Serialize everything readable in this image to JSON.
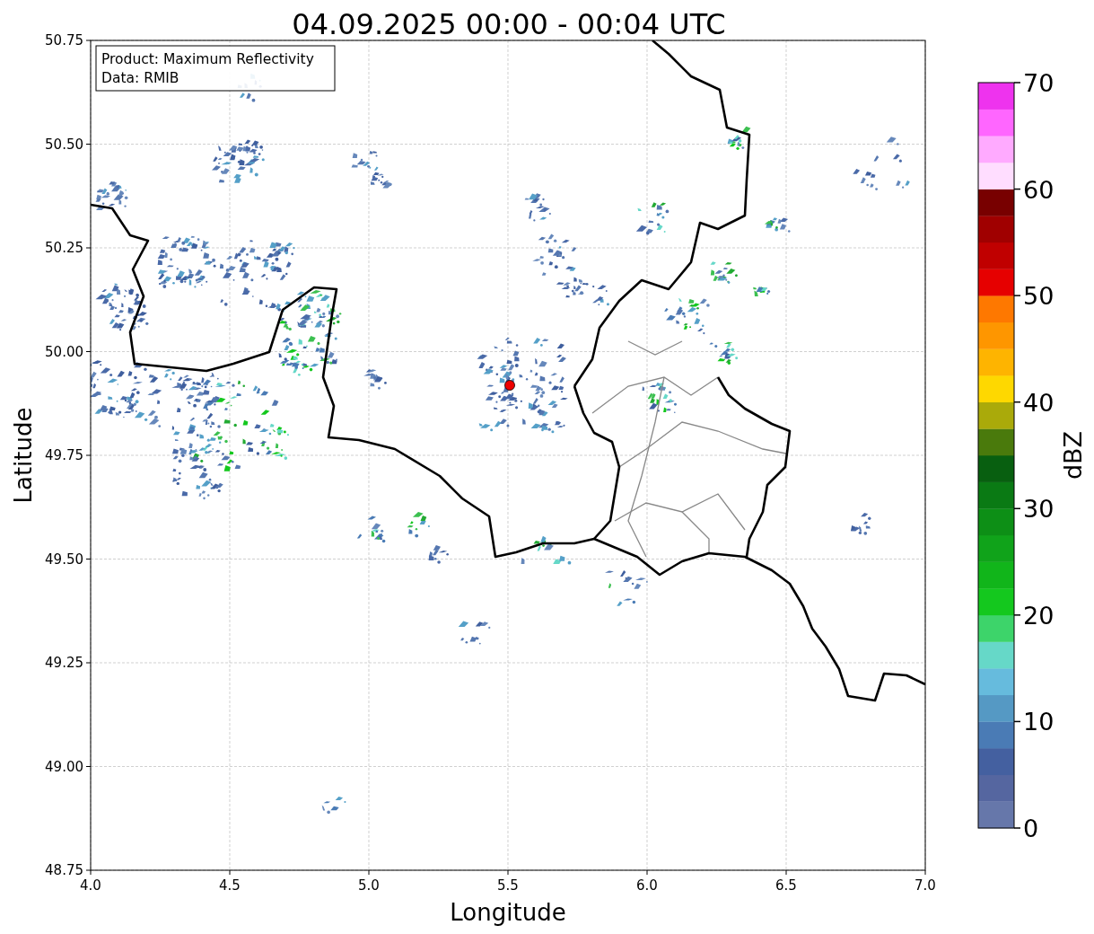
{
  "title": "04.09.2025 00:00 - 00:04 UTC",
  "legend_box": {
    "lines": [
      "Product: Maximum Reflectivity",
      "Data: RMIB"
    ]
  },
  "axes": {
    "xlabel": "Longitude",
    "ylabel": "Latitude",
    "xticks": [
      "4.0",
      "4.5",
      "5.0",
      "5.5",
      "6.0",
      "6.5",
      "7.0"
    ],
    "yticks": [
      "50.75",
      "50.50",
      "50.25",
      "50.00",
      "49.75",
      "49.50",
      "49.25",
      "49.00",
      "48.75"
    ]
  },
  "colorbar": {
    "label": "dBZ",
    "ticks": [
      "70",
      "60",
      "50",
      "40",
      "30",
      "20",
      "10",
      "0"
    ],
    "bins": [
      {
        "color": "#6677aa"
      },
      {
        "color": "#5566a0"
      },
      {
        "color": "#4460a0"
      },
      {
        "color": "#4a7bb5"
      },
      {
        "color": "#5599c4"
      },
      {
        "color": "#66bbdd"
      },
      {
        "color": "#66d8c8"
      },
      {
        "color": "#3dd46a"
      },
      {
        "color": "#14c81e"
      },
      {
        "color": "#11b51a"
      },
      {
        "color": "#10a31a"
      },
      {
        "color": "#0d8f16"
      },
      {
        "color": "#0a7a14"
      },
      {
        "color": "#085f10"
      },
      {
        "color": "#4a7a0c"
      },
      {
        "color": "#aaaa0a"
      },
      {
        "color": "#fed800"
      },
      {
        "color": "#feb400"
      },
      {
        "color": "#fe9600"
      },
      {
        "color": "#fe7800"
      },
      {
        "color": "#e60000"
      },
      {
        "color": "#c00000"
      },
      {
        "color": "#a00000"
      },
      {
        "color": "#780000"
      },
      {
        "color": "#ffddff"
      },
      {
        "color": "#ffaaff"
      },
      {
        "color": "#ff66ff"
      },
      {
        "color": "#ee33ee"
      }
    ]
  }
}
